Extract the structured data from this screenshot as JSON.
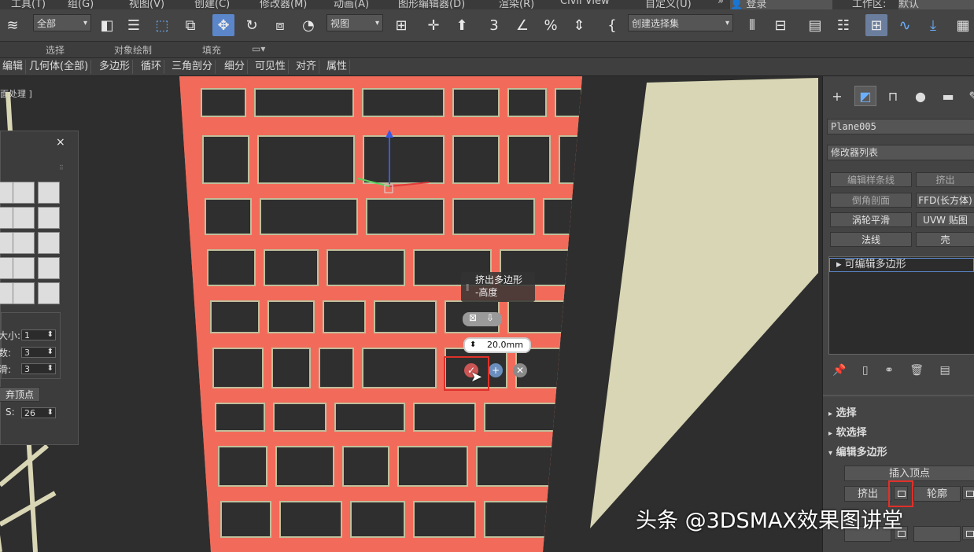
{
  "menubar": {
    "items": [
      "工具(T)",
      "组(G)",
      "视图(V)",
      "创建(C)",
      "修改器(M)",
      "动画(A)",
      "图形编辑器(D)",
      "渲染(R)",
      "Civil View",
      "自定义(U)"
    ],
    "signin": "登录",
    "workspace_label": "工作区:",
    "workspace_value": "默认"
  },
  "toolbar": {
    "selection_filter": "全部",
    "ref_coord": "视图",
    "named_selection": "创建选择集"
  },
  "ribbon": {
    "group_labels": [
      "选择",
      "对象绘制",
      "填充"
    ],
    "tabs": [
      "编辑",
      "几何体(全部)",
      "多边形",
      "循环",
      "三角剖分",
      "细分",
      "可见性",
      "对齐",
      "属性"
    ]
  },
  "viewport": {
    "label": "面处理 ]"
  },
  "material_panel": {
    "close": "×",
    "size_label": "大小:",
    "size_value": "1",
    "count_label": "数:",
    "count_value": "3",
    "smooth_label": "滑:",
    "smooth_value": "3",
    "discard_label": "弃顶点",
    "s_label": "S:",
    "s_value": "26"
  },
  "caddy": {
    "title": "挤出多边形",
    "param": "-高度",
    "value": "20.0mm"
  },
  "command_panel": {
    "object_name": "Plane005",
    "modifier_list": "修改器列表",
    "buttons": [
      "编辑样条线",
      "挤出",
      "倒角剖面",
      "FFD(长方体)",
      "涡轮平滑",
      "UVW 贴图",
      "法线",
      "壳"
    ],
    "stack_item": "可编辑多边形",
    "rollouts": [
      "选择",
      "软选择",
      "编辑多边形"
    ],
    "insert_vertex": "插入顶点",
    "extrude": "挤出",
    "outline": "轮廓"
  },
  "watermark": "头条 @3DSMAX效果图讲堂",
  "colors": {
    "accent": "#5b86c9",
    "frame_red": "#f26b5a",
    "wall_beige": "#d8d6b4",
    "highlight_red": "#e0302a"
  }
}
